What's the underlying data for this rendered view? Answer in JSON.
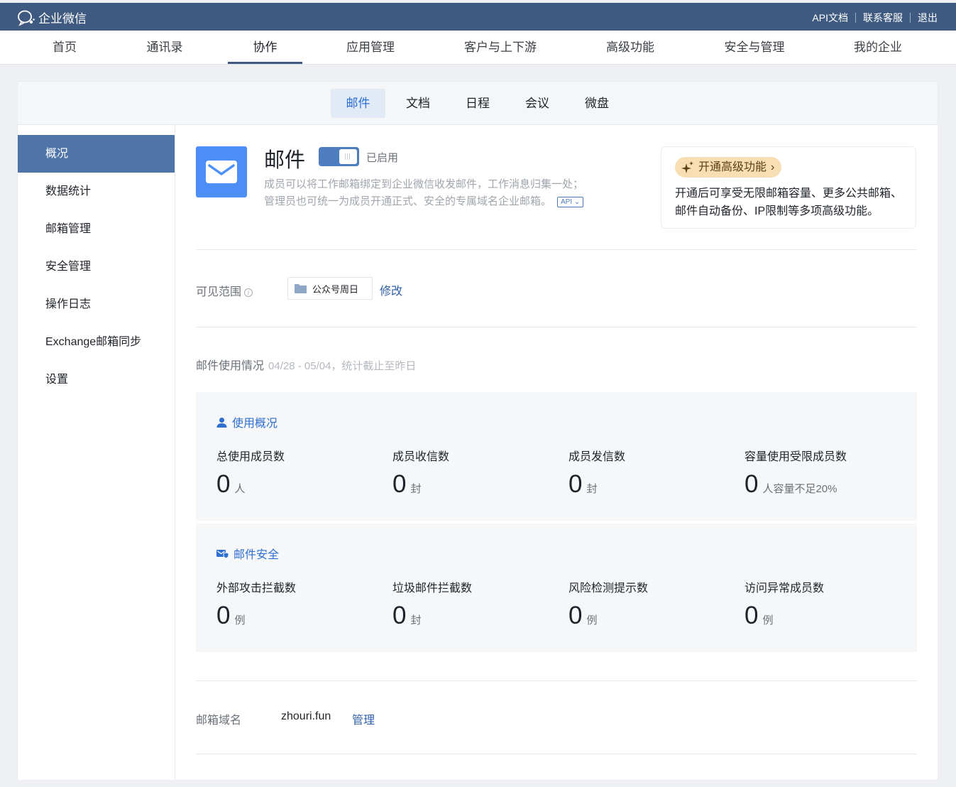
{
  "topbar": {
    "brand": "企业微信",
    "links": [
      "API文档",
      "联系客服",
      "退出"
    ]
  },
  "mainnav": {
    "items": [
      "首页",
      "通讯录",
      "协作",
      "应用管理",
      "客户与上下游",
      "高级功能",
      "安全与管理",
      "我的企业"
    ],
    "active": "协作"
  },
  "subnav": {
    "tabs": [
      "邮件",
      "文档",
      "日程",
      "会议",
      "微盘"
    ],
    "active": "邮件"
  },
  "sidebar": {
    "items": [
      "概况",
      "数据统计",
      "邮箱管理",
      "安全管理",
      "操作日志",
      "Exchange邮箱同步",
      "设置"
    ],
    "active": "概况"
  },
  "app": {
    "title": "邮件",
    "status": "已启用",
    "desc_line1": "成员可以将工作邮箱绑定到企业微信收发邮件，工作消息归集一处；",
    "desc_line2": "管理员也可统一为成员开通正式、安全的专属域名企业邮箱。",
    "api_badge": "API",
    "enabled": true
  },
  "promo": {
    "button": "开通高级功能",
    "text": "开通后可享受无限邮箱容量、更多公共邮箱、邮件自动备份、IP限制等多项高级功能。"
  },
  "scope": {
    "label": "可见范围",
    "info_glyph": "i",
    "value": "公众号周日",
    "edit": "修改"
  },
  "usage": {
    "title": "邮件使用情况",
    "period": "04/28 - 05/04，统计截止至昨日"
  },
  "overview": {
    "title": "使用概况",
    "stats": [
      {
        "name": "总使用成员数",
        "value": "0",
        "unit": "人"
      },
      {
        "name": "成员收信数",
        "value": "0",
        "unit": "封"
      },
      {
        "name": "成员发信数",
        "value": "0",
        "unit": "封"
      },
      {
        "name": "容量使用受限成员数",
        "value": "0",
        "unit": "人容量不足20%"
      }
    ]
  },
  "security": {
    "title": "邮件安全",
    "stats": [
      {
        "name": "外部攻击拦截数",
        "value": "0",
        "unit": "例"
      },
      {
        "name": "垃圾邮件拦截数",
        "value": "0",
        "unit": "封"
      },
      {
        "name": "风险检测提示数",
        "value": "0",
        "unit": "例"
      },
      {
        "name": "访问异常成员数",
        "value": "0",
        "unit": "例"
      }
    ]
  },
  "domain": {
    "label": "邮箱域名",
    "value": "zhouri.fun",
    "manage": "管理"
  },
  "colors": {
    "topbar": "#3f5a80",
    "accent": "#2f6fd0",
    "sidebar_active": "#4e74a8",
    "promo_bg": "#f7dfb3"
  }
}
